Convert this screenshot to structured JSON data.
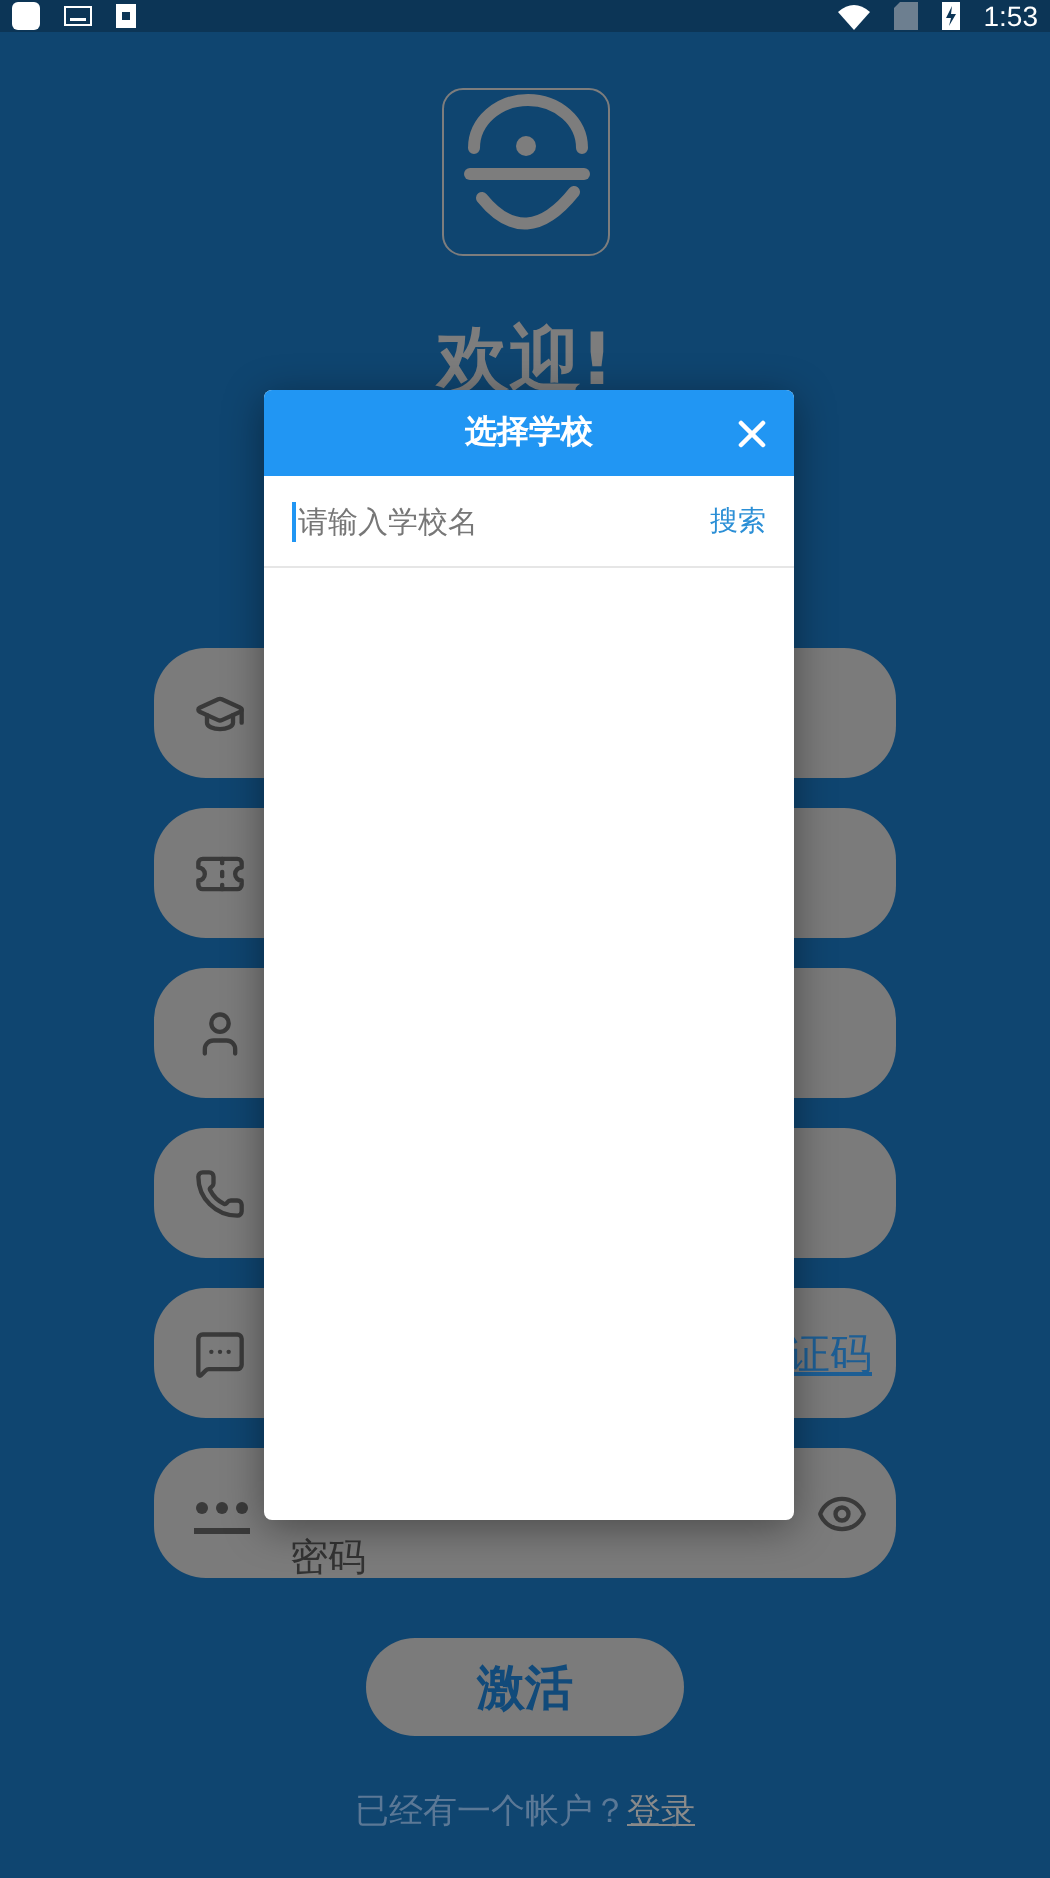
{
  "status_bar": {
    "time": "1:53"
  },
  "welcome": "欢迎!",
  "fields": [
    {
      "kind": "school"
    },
    {
      "kind": "ticket"
    },
    {
      "kind": "person"
    },
    {
      "kind": "phone"
    },
    {
      "kind": "message",
      "link": "证码"
    },
    {
      "kind": "password",
      "placeholder": "密码"
    }
  ],
  "activate_button": "激活",
  "footer": {
    "prompt": "已经有一个帐户？",
    "link": "登录"
  },
  "dialog": {
    "title": "选择学校",
    "search": {
      "placeholder": "请输入学校名"
    },
    "search_button": "搜索"
  }
}
